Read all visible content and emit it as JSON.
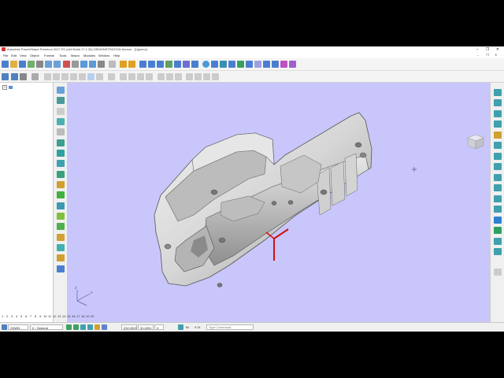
{
  "window": {
    "title": "Autodesk PowerShape Premium 2017 R1 (x64 Build 17.1.26) DEMONSTRATION licence - [Ujpemo]",
    "controls": [
      "–",
      "❐",
      "✕"
    ]
  },
  "menu": {
    "items": [
      "File",
      "Edit",
      "View",
      "Object",
      "Format",
      "Tools",
      "Macro",
      "Modules",
      "Window",
      "Help"
    ],
    "mdi_controls": [
      "–",
      "❐",
      "✕"
    ]
  },
  "tree": {
    "root_expander": "+"
  },
  "ruler_numbers": [
    "1",
    "2",
    "3",
    "4",
    "5",
    "6",
    "7",
    "8",
    "9",
    "10",
    "11",
    "12",
    "13",
    "14",
    "15",
    "16",
    "17",
    "18",
    "19",
    "20"
  ],
  "status": {
    "workplane": "XDWN",
    "level_num": "0",
    "level_name": "General",
    "x_value": "232.2021",
    "y_value": "31.0291",
    "z_value": "0",
    "tol_label": "Tol",
    "tol_value": "0.01",
    "command_placeholder": "Type Command"
  },
  "colors": {
    "viewport_bg": "#c8c6fa",
    "model_surface": "#d8d8d8",
    "axis_marker": "#d01010",
    "outer_bg": "#000000"
  }
}
